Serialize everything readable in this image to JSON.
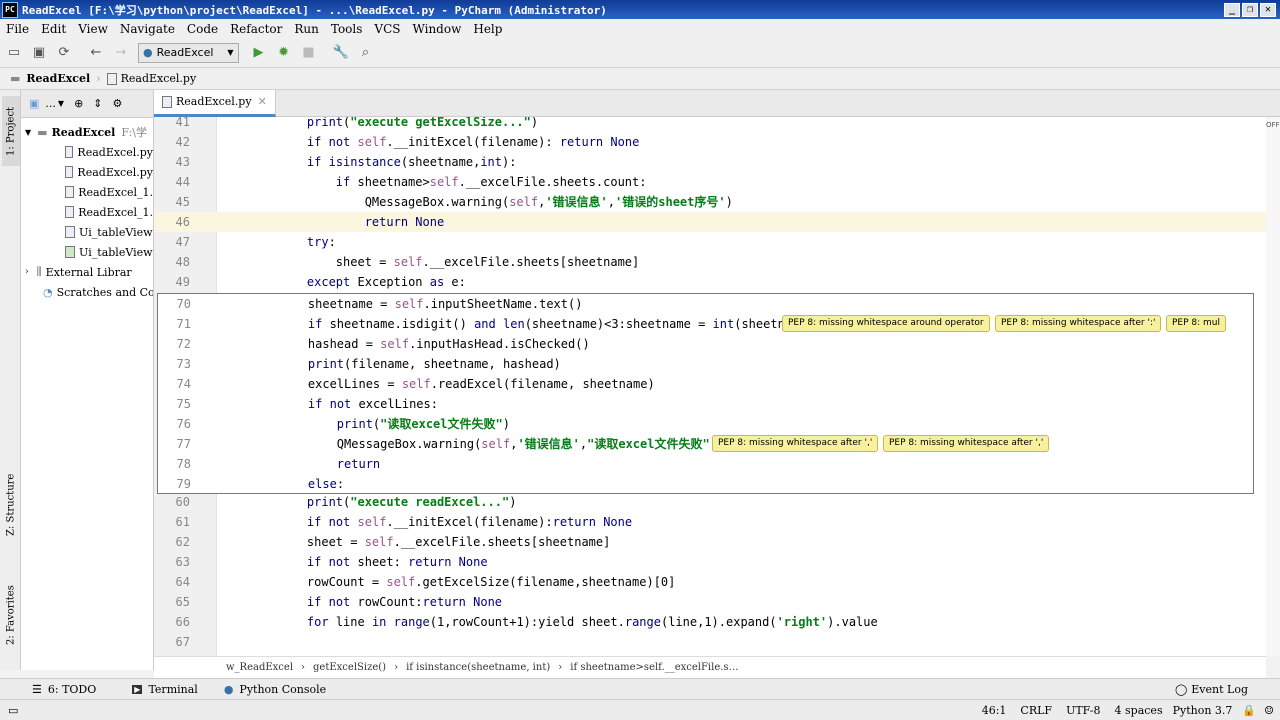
{
  "window": {
    "title": "ReadExcel [F:\\学习\\python\\project\\ReadExcel] - ...\\ReadExcel.py - PyCharm (Administrator)",
    "app_icon": "PC"
  },
  "menu": [
    "File",
    "Edit",
    "View",
    "Navigate",
    "Code",
    "Refactor",
    "Run",
    "Tools",
    "VCS",
    "Window",
    "Help"
  ],
  "toolbar": {
    "run_config": "ReadExcel"
  },
  "nav": {
    "project": "ReadExcel",
    "file": "ReadExcel.py"
  },
  "left_tools": {
    "project": "1: Project",
    "structure": "Z: Structure",
    "favorites": "2: Favorites"
  },
  "project_panel": {
    "header_dots": "...",
    "root": "ReadExcel",
    "root_path": "F:\\学",
    "files": [
      "ReadExcel.py",
      "ReadExcel.py",
      "ReadExcel_1.",
      "ReadExcel_1.",
      "Ui_tableView",
      "Ui_tableView"
    ],
    "external": "External Librar",
    "scratches": "Scratches and Co"
  },
  "editor": {
    "tab": "ReadExcel.py",
    "main_lines": [
      {
        "n": "41",
        "t": "    print(\"execute getExcelSize...\")"
      },
      {
        "n": "42",
        "t": "    if not self.__initExcel(filename): return None"
      },
      {
        "n": "43",
        "t": "    if isinstance(sheetname,int):"
      },
      {
        "n": "44",
        "t": "        if sheetname>self.__excelFile.sheets.count:"
      },
      {
        "n": "45",
        "t": "            QMessageBox.warning(self,'错误信息','错误的sheet序号')"
      },
      {
        "n": "46",
        "t": "            return None"
      },
      {
        "n": "47",
        "t": "    try:"
      },
      {
        "n": "48",
        "t": "        sheet = self.__excelFile.sheets[sheetname]"
      },
      {
        "n": "49",
        "t": "    except Exception as e:"
      }
    ],
    "popup_lines": [
      {
        "n": "70",
        "t": "    sheetname = self.inputSheetName.text()"
      },
      {
        "n": "71",
        "t": "    if sheetname.isdigit() and len(sheetname)<3:sheetname = int(sheetname)"
      },
      {
        "n": "72",
        "t": "    hashead = self.inputHasHead.isChecked()"
      },
      {
        "n": "73",
        "t": "    print(filename, sheetname, hashead)"
      },
      {
        "n": "74",
        "t": "    excelLines = self.readExcel(filename, sheetname)"
      },
      {
        "n": "75",
        "t": "    if not excelLines:"
      },
      {
        "n": "76",
        "t": "        print(\"读取excel文件失败\")"
      },
      {
        "n": "77",
        "t": "        QMessageBox.warning(self,'错误信息',\"读取excel文件失败\")"
      },
      {
        "n": "78",
        "t": "        return"
      },
      {
        "n": "79",
        "t": "    else:"
      }
    ],
    "after_lines": [
      {
        "n": "60",
        "t": "    print(\"execute readExcel...\")"
      },
      {
        "n": "61",
        "t": "    if not self.__initExcel(filename):return None"
      },
      {
        "n": "62",
        "t": "    sheet = self.__excelFile.sheets[sheetname]"
      },
      {
        "n": "63",
        "t": "    if not sheet: return None"
      },
      {
        "n": "64",
        "t": "    rowCount = self.getExcelSize(filename,sheetname)[0]"
      },
      {
        "n": "65",
        "t": "    if not rowCount:return None"
      },
      {
        "n": "66",
        "t": "    for line in range(1,rowCount+1):yield sheet.range(line,1).expand('right').value"
      },
      {
        "n": "67",
        "t": ""
      }
    ],
    "pep71": [
      "PEP 8: missing whitespace around operator",
      "PEP 8: missing whitespace after ':'",
      "PEP 8: mul"
    ],
    "pep77": [
      "PEP 8: missing whitespace after ','",
      "PEP 8: missing whitespace after ','"
    ],
    "off_label": "OFF"
  },
  "crumbs": [
    "w_ReadExcel",
    "getExcelSize()",
    "if isinstance(sheetname, int)",
    "if sheetname>self.__excelFile.s…"
  ],
  "bottom_tools": {
    "todo": "6: TODO",
    "terminal": "Terminal",
    "console": "Python Console",
    "eventlog": "Event Log"
  },
  "status": {
    "pos": "46:1",
    "eol": "CRLF",
    "enc": "UTF-8",
    "indent": "4 spaces",
    "interp": "Python 3.7"
  },
  "colors": {
    "title_bar": "#1f50b4",
    "selection_line": "#fcf6e0",
    "pep_bg": "#f7f19e"
  }
}
